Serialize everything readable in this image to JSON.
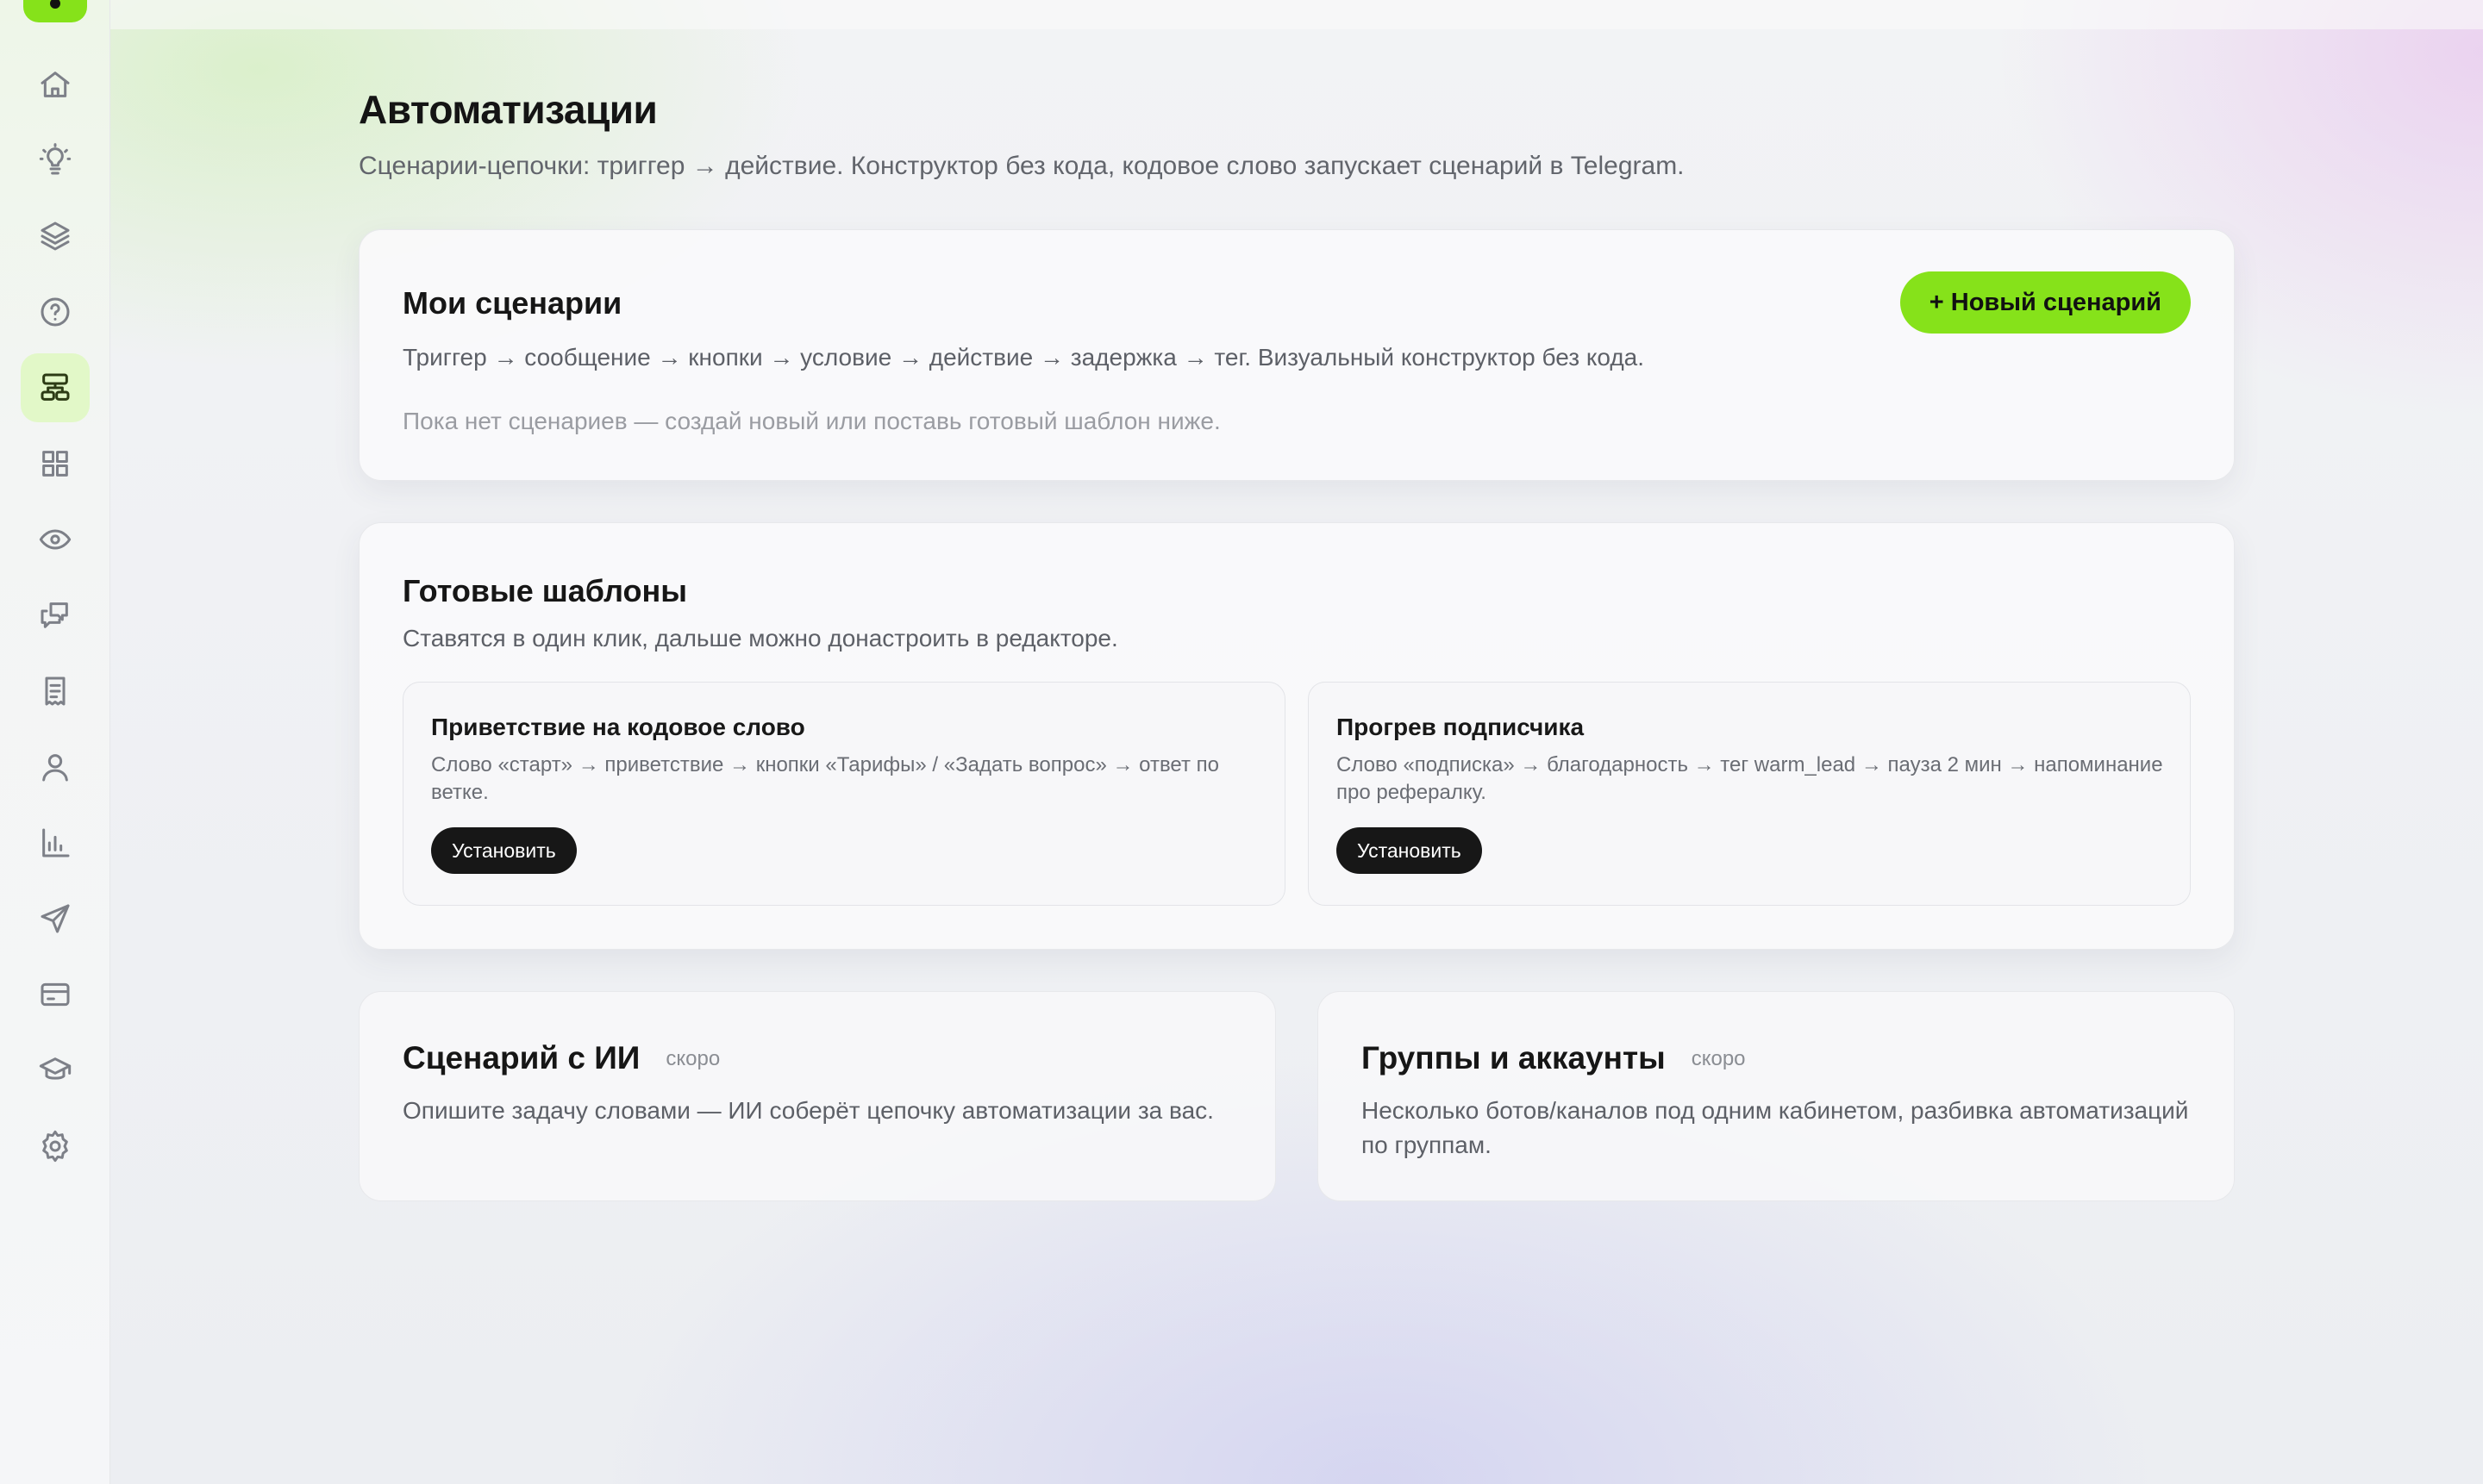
{
  "sidebar": {
    "items": [
      {
        "icon": "home-icon"
      },
      {
        "icon": "lightbulb-icon"
      },
      {
        "icon": "layers-icon"
      },
      {
        "icon": "help-circle-icon"
      },
      {
        "icon": "workflow-icon",
        "active": true
      },
      {
        "icon": "grid-icon"
      },
      {
        "icon": "eye-icon"
      },
      {
        "icon": "chat-icon"
      },
      {
        "icon": "receipt-icon"
      },
      {
        "icon": "user-icon"
      },
      {
        "icon": "bar-chart-icon"
      },
      {
        "icon": "send-icon"
      },
      {
        "icon": "credit-card-icon"
      },
      {
        "icon": "graduation-cap-icon"
      },
      {
        "icon": "settings-icon"
      }
    ],
    "accent_color": "#86e21a"
  },
  "page": {
    "title": "Автоматизации",
    "subtitle": "Сценарии-цепочки: триггер → действие. Конструктор без кода, кодовое слово запускает сценарий в Telegram."
  },
  "my_scenarios": {
    "title": "Мои сценарии",
    "new_button": "+ Новый сценарий",
    "description": "Триггер → сообщение → кнопки → условие → действие → задержка → тег. Визуальный конструктор без кода.",
    "empty_text": "Пока нет сценариев — создай новый или поставь готовый шаблон ниже."
  },
  "templates": {
    "title": "Готовые шаблоны",
    "description": "Ставятся в один клик, дальше можно донастроить в редакторе.",
    "items": [
      {
        "title": "Приветствие на кодовое слово",
        "description": "Слово «старт» → приветствие → кнопки «Тарифы» / «Задать вопрос» → ответ по ветке.",
        "button": "Установить"
      },
      {
        "title": "Прогрев подписчика",
        "description": "Слово «подписка» → благодарность → тег warm_lead → пауза 2 мин → напоминание про рефералку.",
        "button": "Установить"
      }
    ]
  },
  "features": [
    {
      "title": "Сценарий с ИИ",
      "badge": "скоро",
      "description": "Опишите задачу словами — ИИ соберёт цепочку автоматизации за вас."
    },
    {
      "title": "Группы и аккаунты",
      "badge": "скоро",
      "description": "Несколько ботов/каналов под одним кабинетом, разбивка автоматизаций по группам."
    }
  ]
}
